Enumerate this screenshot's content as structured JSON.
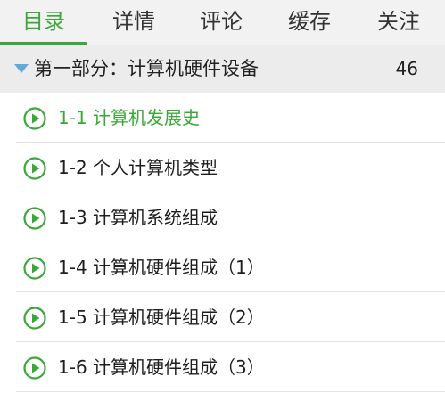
{
  "tabs": [
    {
      "label": "目录",
      "active": true
    },
    {
      "label": "详情",
      "active": false
    },
    {
      "label": "评论",
      "active": false
    },
    {
      "label": "缓存",
      "active": false
    },
    {
      "label": "关注",
      "active": false
    }
  ],
  "section": {
    "title": "第一部分：计算机硬件设备",
    "count": "46",
    "expand_icon": "triangle-down-icon"
  },
  "lessons": [
    {
      "label": "1-1 计算机发展史",
      "active": true,
      "icon": "play-circle-icon"
    },
    {
      "label": "1-2 个人计算机类型",
      "active": false,
      "icon": "play-circle-icon"
    },
    {
      "label": "1-3 计算机系统组成",
      "active": false,
      "icon": "play-circle-icon"
    },
    {
      "label": "1-4 计算机硬件组成（1）",
      "active": false,
      "icon": "play-circle-icon"
    },
    {
      "label": "1-5 计算机硬件组成（2）",
      "active": false,
      "icon": "play-circle-icon"
    },
    {
      "label": "1-6 计算机硬件组成（3）",
      "active": false,
      "icon": "play-circle-icon"
    }
  ],
  "colors": {
    "accent": "#3aa838",
    "triangle": "#62a9d9"
  }
}
